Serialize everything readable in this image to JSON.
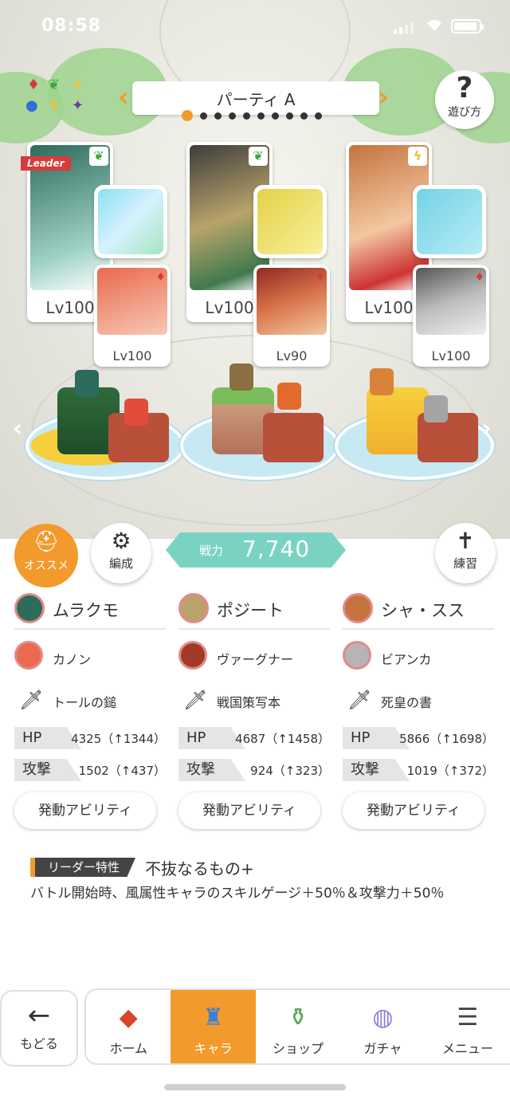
{
  "status": {
    "time": "08:58"
  },
  "party": {
    "title": "パーティ A",
    "dot_count": 10,
    "active_dot": 0
  },
  "help": {
    "label": "遊び方"
  },
  "members": [
    {
      "level": "Lv100",
      "leader_badge": "Leader",
      "element": "wind",
      "sub_level": "Lv100",
      "color": "#2d6b5a"
    },
    {
      "level": "Lv100",
      "element": "wind",
      "sub_level": "Lv90",
      "color": "#b9a36a"
    },
    {
      "level": "Lv100",
      "element": "thunder",
      "sub_level": "Lv100",
      "color": "#c4733d"
    }
  ],
  "controls": {
    "recommend": "オススメ",
    "formation": "編成",
    "training": "練習",
    "power_label": "戦力",
    "power_value": "7,740"
  },
  "columns": [
    {
      "name": "ムラクモ",
      "sub": "カノン",
      "weapon": "トールの鎚",
      "hp_label": "HP",
      "hp": "4325（↑1344）",
      "atk_label": "攻撃",
      "atk": "1502（↑437）",
      "ability": "発動アビリティ"
    },
    {
      "name": "ポジート",
      "sub": "ヴァーグナー",
      "weapon": "戦国策写本",
      "hp_label": "HP",
      "hp": "4687（↑1458）",
      "atk_label": "攻撃",
      "atk": "924（↑323）",
      "ability": "発動アビリティ"
    },
    {
      "name": "シャ・スス",
      "sub": "ビアンカ",
      "weapon": "死皇の書",
      "hp_label": "HP",
      "hp": "5866（↑1698）",
      "atk_label": "攻撃",
      "atk": "1019（↑372）",
      "ability": "発動アビリティ"
    }
  ],
  "leader_skill": {
    "tag": "リーダー特性",
    "name": "不抜なるもの+",
    "description": "バトル開始時、風属性キャラのスキルゲージ＋50％＆攻撃力＋50％"
  },
  "nav": {
    "back": "もどる",
    "tabs": [
      {
        "label": "ホーム",
        "icon": "home-icon",
        "active": false
      },
      {
        "label": "キャラ",
        "icon": "character-icon",
        "active": true
      },
      {
        "label": "ショップ",
        "icon": "shop-icon",
        "active": false
      },
      {
        "label": "ガチャ",
        "icon": "gacha-icon",
        "active": false
      },
      {
        "label": "メニュー",
        "icon": "menu-icon",
        "active": false
      }
    ]
  },
  "colors": {
    "accent": "#f39a2c",
    "teal": "#7ad3c2",
    "suit_red": "#d73b3b"
  }
}
